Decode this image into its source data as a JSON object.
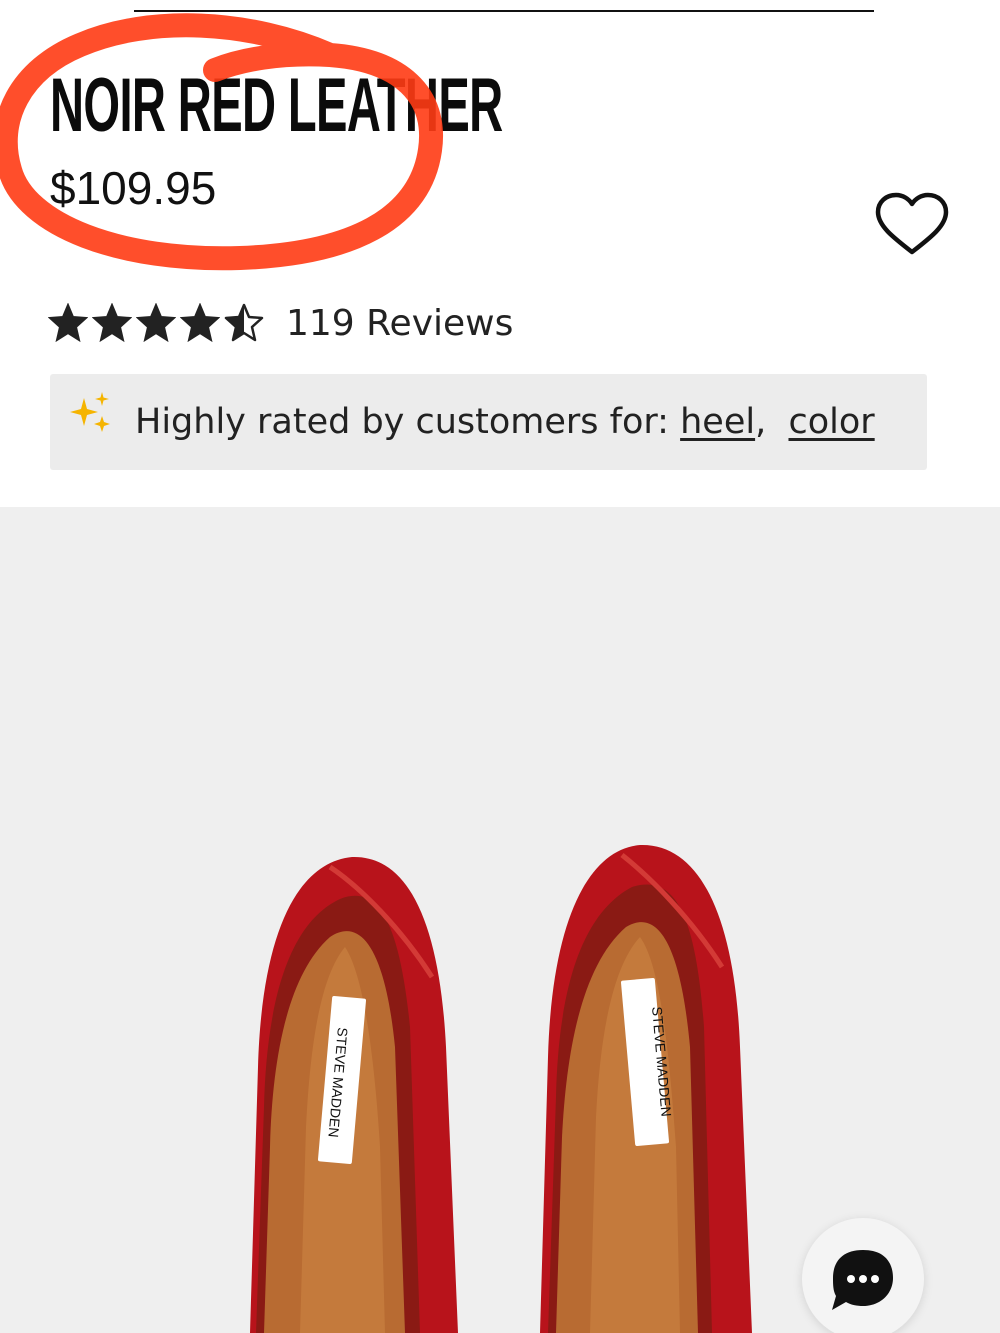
{
  "product": {
    "title": "NOIR RED LEATHER",
    "price": "$109.95",
    "rating": 4.5,
    "rating_max": 5,
    "reviews_label": "119 Reviews"
  },
  "highlights": {
    "prefix": "Highly rated by customers for: ",
    "tags": [
      "heel",
      "color"
    ],
    "separator": ",  "
  },
  "image": {
    "brand_label": "STEVE MADDEN",
    "shoe_color": "#b8131b",
    "background_color": "#efefef"
  },
  "icons": {
    "wishlist": "heart-outline-icon",
    "sparkle": "sparkle-icon",
    "chat": "chat-bubble-icon",
    "back": "chevron-left-icon"
  },
  "colors": {
    "annotation": "#ff3b14",
    "sparkle": "#f5b400",
    "text": "#111111"
  }
}
